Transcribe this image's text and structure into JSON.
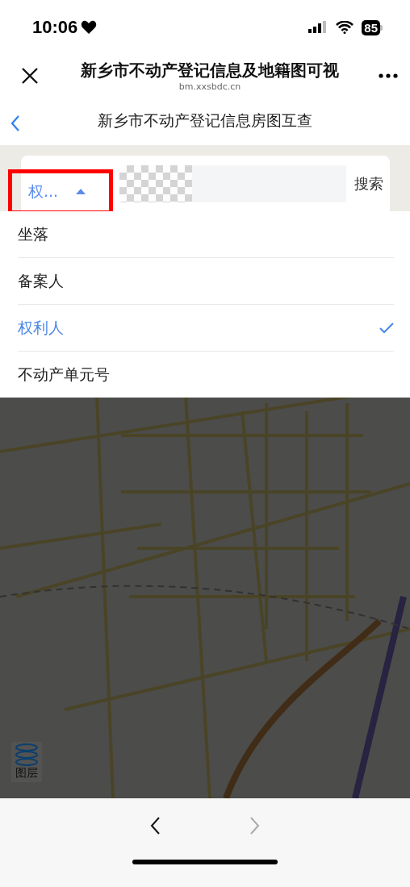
{
  "status_bar": {
    "time": "10:06",
    "battery": "85"
  },
  "browser_bar": {
    "title": "新乡市不动产登记信息及地籍图可视",
    "url": "bm.xxsbdc.cn"
  },
  "page_header": {
    "title": "新乡市不动产登记信息房图互查"
  },
  "search": {
    "field_type": "权...",
    "expanded": true,
    "button": "搜索"
  },
  "field_options": [
    {
      "label": "坐落",
      "selected": false
    },
    {
      "label": "备案人",
      "selected": false
    },
    {
      "label": "权利人",
      "selected": true
    },
    {
      "label": "不动产单元号",
      "selected": false
    }
  ],
  "layers_button": {
    "label": "图层"
  },
  "bottom_nav": {
    "back_disabled": false,
    "forward_disabled": true
  }
}
